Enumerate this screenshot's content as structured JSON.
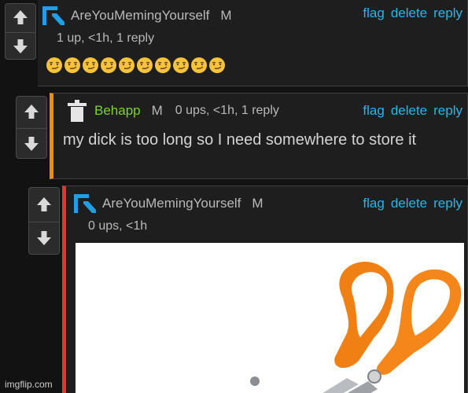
{
  "comments": [
    {
      "username": "AreYouMemingYourself",
      "mod": "M",
      "meta": "1 up, <1h, 1 reply",
      "emoji_count": 10,
      "actions": [
        "flag",
        "delete",
        "reply"
      ]
    },
    {
      "username": "Behapp",
      "mod": "M",
      "meta": "0 ups, <1h, 1 reply",
      "text": "my dick is too long so I need somewhere to store it",
      "actions": [
        "flag",
        "delete",
        "reply"
      ]
    },
    {
      "username": "AreYouMemingYourself",
      "mod": "M",
      "meta": "0 ups, <1h",
      "image_desc": "orange-handled scissors",
      "actions": [
        "flag",
        "delete",
        "reply"
      ]
    }
  ],
  "watermark": "imgflip.com",
  "colors": {
    "background": "#121212",
    "link": "#29b6e6",
    "nest_orange": "#f28c00",
    "nest_red": "#e23535",
    "username_green": "#7fd03c"
  }
}
